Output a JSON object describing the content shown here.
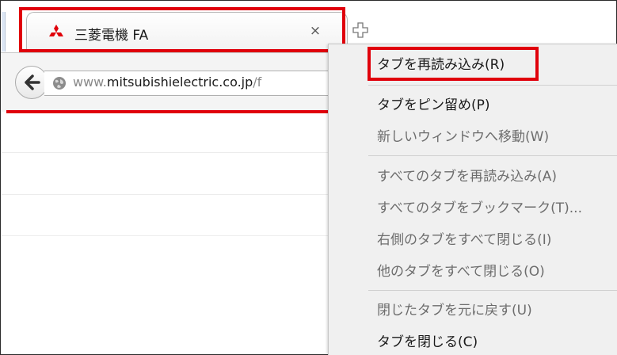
{
  "tab": {
    "title": "三菱電機 FA",
    "close_glyph": "×",
    "favicon": "mitsubishi-logo-icon",
    "favicon_color": "#e0000b"
  },
  "newtab": {
    "icon": "plus-icon"
  },
  "navbar": {
    "back_icon": "back-arrow-icon",
    "url_prefix": "www.",
    "url_domain": "mitsubishielectric.co.jp",
    "url_suffix": "/f"
  },
  "menu": {
    "items": [
      {
        "label": "タブを再読み込み(R)",
        "enabled": true
      },
      {
        "label": "タブをピン留め(P)",
        "enabled": true
      },
      {
        "label": "新しいウィンドウへ移動(W)",
        "enabled": false
      },
      {
        "label": "すべてのタブを再読み込み(A)",
        "enabled": false
      },
      {
        "label": "すべてのタブをブックマーク(T)...",
        "enabled": false
      },
      {
        "label": "右側のタブをすべて閉じる(I)",
        "enabled": false
      },
      {
        "label": "他のタブをすべて閉じる(O)",
        "enabled": false
      },
      {
        "label": "閉じたタブを元に戻す(U)",
        "enabled": false
      },
      {
        "label": "タブを閉じる(C)",
        "enabled": true
      }
    ]
  },
  "highlight_color": "#e0000b"
}
